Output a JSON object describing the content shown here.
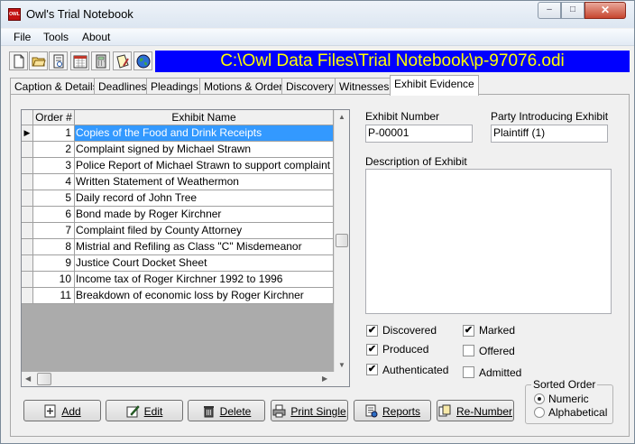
{
  "window": {
    "title": "Owl's Trial Notebook",
    "icon_text": "OWL",
    "min_glyph": "–",
    "max_glyph": "□",
    "close_glyph": "✕"
  },
  "menu": [
    "File",
    "Tools",
    "About"
  ],
  "toolbar": {
    "icons": [
      "new-file-icon",
      "open-folder-icon",
      "print-preview-icon",
      "calendar-icon",
      "calculator-icon",
      "notes-icon",
      "globe-icon"
    ],
    "path": "C:\\Owl Data Files\\Trial Notebook\\p-97076.odi",
    "path_bg": "#0000ff",
    "path_fg": "#ffff00"
  },
  "tabs": [
    "Caption & Details",
    "Deadlines",
    "Pleadings",
    "Motions & Orders",
    "Discovery",
    "Witnesses",
    "Exhibit Evidence"
  ],
  "active_tab": "Exhibit Evidence",
  "grid": {
    "columns": [
      "Order #",
      "Exhibit Name"
    ],
    "rows": [
      {
        "order": "1",
        "name": "Copies of the Food and Drink Receipts"
      },
      {
        "order": "2",
        "name": "Complaint signed by Michael Strawn"
      },
      {
        "order": "3",
        "name": "Police Report of Michael Strawn to support complaint"
      },
      {
        "order": "4",
        "name": "Written Statement of Weathermon"
      },
      {
        "order": "5",
        "name": "Daily record of John Tree"
      },
      {
        "order": "6",
        "name": "Bond made by Roger Kirchner"
      },
      {
        "order": "7",
        "name": "Complaint filed by County Attorney"
      },
      {
        "order": "8",
        "name": "Mistrial and Refiling as Class \"C\" Misdemeanor"
      },
      {
        "order": "9",
        "name": "Justice Court Docket Sheet"
      },
      {
        "order": "10",
        "name": "Income tax of Roger Kirchner 1992 to 1996"
      },
      {
        "order": "11",
        "name": "Breakdown of economic loss by Roger Kirchner"
      }
    ],
    "selected_row": 0,
    "row_pointer": "▶",
    "selection_color": "#3399ff"
  },
  "fields": {
    "exhibit_number_label": "Exhibit Number",
    "exhibit_number_value": "P-00001",
    "party_label": "Party Introducing Exhibit",
    "party_value": "Plaintiff (1)",
    "description_label": "Description of Exhibit",
    "description_value": ""
  },
  "checkboxes": [
    {
      "label": "Discovered",
      "checked": true
    },
    {
      "label": "Produced",
      "checked": true
    },
    {
      "label": "Authenticated",
      "checked": true
    },
    {
      "label": "Marked",
      "checked": true
    },
    {
      "label": "Offered",
      "checked": false
    },
    {
      "label": "Admitted",
      "checked": false
    }
  ],
  "check_mark": "✔",
  "sorted_order": {
    "title": "Sorted Order",
    "options": [
      "Numeric",
      "Alphabetical"
    ],
    "selected": "Numeric"
  },
  "buttons": [
    {
      "label": "Add",
      "icon": "add-icon"
    },
    {
      "label": "Edit",
      "icon": "edit-icon"
    },
    {
      "label": "Delete",
      "icon": "trash-icon"
    },
    {
      "label": "Print Single",
      "icon": "printer-icon"
    },
    {
      "label": "Reports",
      "icon": "reports-icon"
    },
    {
      "label": "Re-Number",
      "icon": "renumber-icon"
    }
  ]
}
